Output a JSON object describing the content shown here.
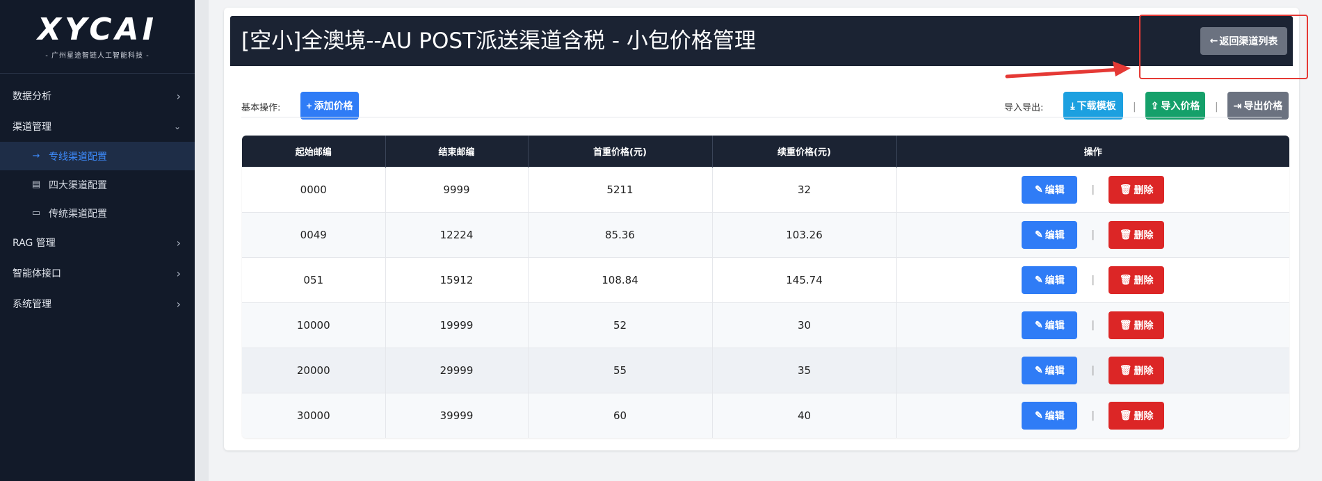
{
  "sidebar": {
    "logo_text": "XYCAI",
    "logo_sub": "- 广州星途智链人工智能科技 -",
    "items": [
      {
        "label": "数据分析",
        "icon": "chevron-right-icon"
      },
      {
        "label": "渠道管理",
        "icon": "chevron-down-icon"
      },
      {
        "label": "RAG 管理",
        "icon": "chevron-right-icon"
      },
      {
        "label": "智能体接口",
        "icon": "chevron-right-icon"
      },
      {
        "label": "系统管理",
        "icon": "chevron-right-icon"
      }
    ],
    "subitems": [
      {
        "label": "专线渠道配置",
        "icon": "arrow-right-icon",
        "active": true
      },
      {
        "label": "四大渠道配置",
        "icon": "list-icon",
        "active": false
      },
      {
        "label": "传统渠道配置",
        "icon": "folder-icon",
        "active": false
      }
    ]
  },
  "header": {
    "title": "[空小]全澳境--AU POST派送渠道含税 - 小包价格管理",
    "back_button": "返回渠道列表"
  },
  "toolbar": {
    "basic_label": "基本操作:",
    "add_price": "添加价格",
    "import_export_label": "导入导出:",
    "download_template": "下载模板",
    "import_price": "导入价格",
    "export_price": "导出价格",
    "separator": "|"
  },
  "table": {
    "columns": [
      "起始邮编",
      "结束邮编",
      "首重价格(元)",
      "续重价格(元)",
      "操作"
    ],
    "rows": [
      [
        "0000",
        "9999",
        "5211",
        "32"
      ],
      [
        "0049",
        "12224",
        "85.36",
        "103.26"
      ],
      [
        "051",
        "15912",
        "108.84",
        "145.74"
      ],
      [
        "10000",
        "19999",
        "52",
        "30"
      ],
      [
        "20000",
        "29999",
        "55",
        "35"
      ],
      [
        "30000",
        "39999",
        "60",
        "40"
      ]
    ],
    "edit_label": "编辑",
    "delete_label": "删除"
  },
  "colors": {
    "sidebar_bg": "#121a29",
    "header_bg": "#1b2333",
    "primary": "#2f7cf6",
    "info": "#1ca0e0",
    "success": "#15a06a",
    "secondary": "#6b7280",
    "danger": "#dc2626",
    "annotation": "#e53935"
  }
}
